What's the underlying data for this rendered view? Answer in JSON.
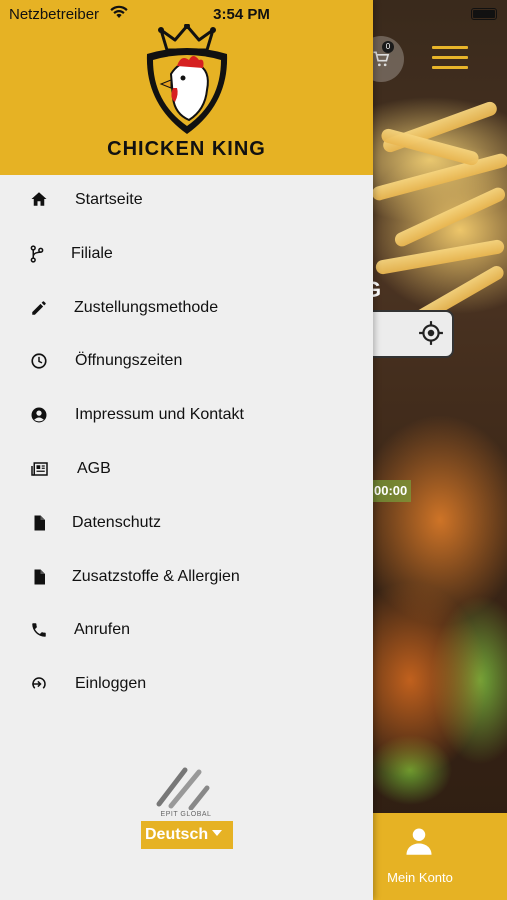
{
  "status_bar": {
    "carrier": "Netzbetreiber",
    "time": "3:54 PM"
  },
  "drawer": {
    "brand_name": "CHICKEN KING",
    "items": [
      {
        "label": "Startseite",
        "icon": "home-icon"
      },
      {
        "label": "Filiale",
        "icon": "branch-icon"
      },
      {
        "label": "Zustellungsmethode",
        "icon": "pencil-icon"
      },
      {
        "label": "Öffnungszeiten",
        "icon": "clock-icon"
      },
      {
        "label": "Impressum und Kontakt",
        "icon": "account-circle-icon"
      },
      {
        "label": "AGB",
        "icon": "newspaper-icon"
      },
      {
        "label": "Datenschutz",
        "icon": "document-icon"
      },
      {
        "label": "Zusatzstoffe & Allergien",
        "icon": "document-icon"
      },
      {
        "label": "Anrufen",
        "icon": "phone-icon"
      },
      {
        "label": "Einloggen",
        "icon": "login-icon"
      }
    ],
    "footer_logo_text": "EPIT GLOBAL",
    "language": "Deutsch"
  },
  "background": {
    "cart_count": "0",
    "partial_heading": "G",
    "partial_time": "00:00",
    "bottom_tab_label": "Mein Konto"
  },
  "colors": {
    "accent": "#e6b224",
    "drawer_bg": "#efefef",
    "text": "#111111"
  }
}
